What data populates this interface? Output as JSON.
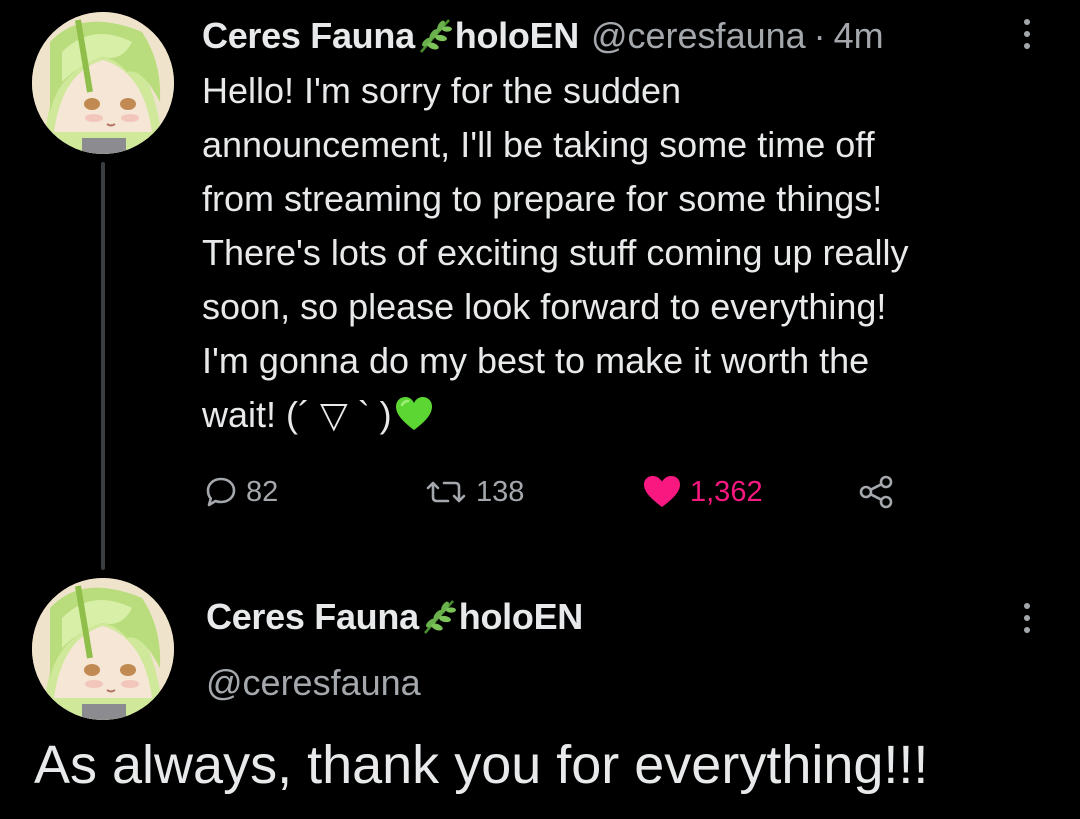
{
  "tweets": [
    {
      "display_name": "Ceres Fauna",
      "verified_suffix": "holoEN",
      "handle": "@ceresfauna",
      "separator": "·",
      "time": "4m",
      "body_lines": [
        "Hello! I'm sorry for the sudden",
        "announcement, I'll be taking some time off",
        "from streaming to prepare for some things!",
        "There's lots of exciting stuff coming up really",
        "soon, so please look forward to everything!",
        "I'm gonna do my best to make it worth the",
        "wait! (´ ▽ ` )"
      ],
      "actions": {
        "replies": "82",
        "retweets": "138",
        "likes": "1,362"
      }
    },
    {
      "display_name": "Ceres Fauna",
      "verified_suffix": "holoEN",
      "handle": "@ceresfauna",
      "body": "As always, thank you for everything!!!"
    }
  ],
  "icons": {
    "name_emoji": "herb-leaf-icon",
    "reply": "speech-bubble-icon",
    "retweet": "retweet-arrows-icon",
    "like": "heart-icon",
    "share": "share-nodes-icon",
    "more": "vertical-ellipsis-icon",
    "body_emoji": "green-heart-icon"
  },
  "colors": {
    "background": "#000000",
    "text_primary": "#e7e9ea",
    "text_secondary": "#a4a8ad",
    "like_pink": "#f91880",
    "heart_green": "#5bd633",
    "thread_line": "#3a3d41"
  }
}
